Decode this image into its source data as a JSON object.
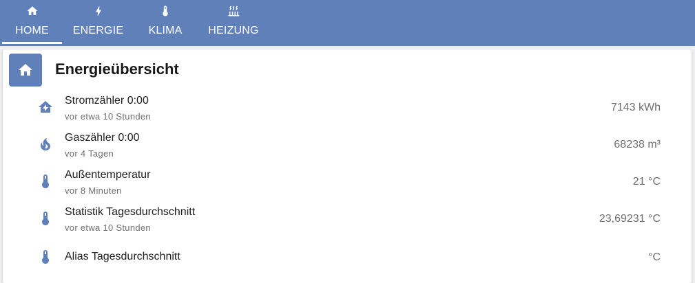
{
  "tabs": [
    {
      "label": "HOME",
      "icon": "home-icon",
      "active": true
    },
    {
      "label": "ENERGIE",
      "icon": "lightning-icon",
      "active": false
    },
    {
      "label": "KLIMA",
      "icon": "thermometer-icon",
      "active": false
    },
    {
      "label": "HEIZUNG",
      "icon": "radiator-icon",
      "active": false
    }
  ],
  "card": {
    "title": "Energieübersicht",
    "icon": "home-icon",
    "rows": [
      {
        "name": "Stromzähler 0:00",
        "sub": "vor etwa 10 Stunden",
        "value": "7143 kWh",
        "icon": "home-lightning-icon"
      },
      {
        "name": "Gaszähler 0:00",
        "sub": "vor 4 Tagen",
        "value": "68238 m³",
        "icon": "fire-icon"
      },
      {
        "name": "Außentemperatur",
        "sub": "vor 8 Minuten",
        "value": "21 °C",
        "icon": "thermometer-icon"
      },
      {
        "name": "Statistik Tagesdurchschnitt",
        "sub": "vor etwa 10 Stunden",
        "value": "23,69231 °C",
        "icon": "thermometer-icon"
      },
      {
        "name": "Alias Tagesdurchschnitt",
        "sub": "",
        "value": "°C",
        "icon": "thermometer-icon"
      }
    ]
  },
  "colors": {
    "accent": "#5f80b8",
    "text": "#212121",
    "secondary": "#6f6f6f"
  }
}
